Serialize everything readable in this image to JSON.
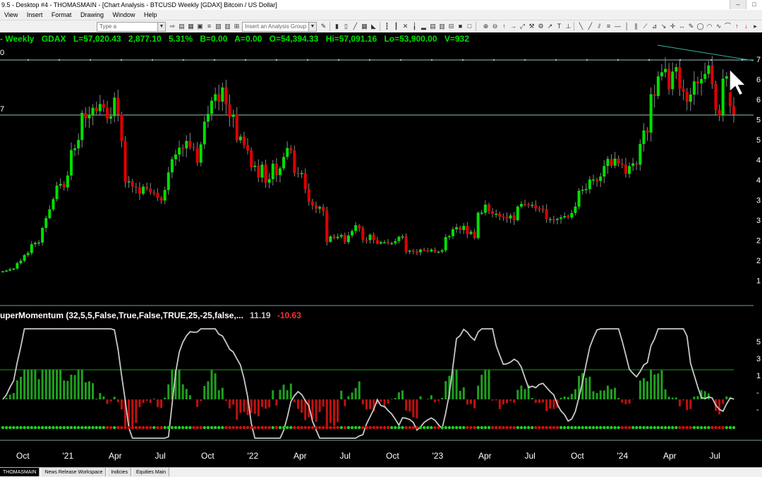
{
  "window": {
    "title": "9.5 - Desktop #4 - THOMASMAIN - [Chart Analysis - BTCUSD Weekly [GDAX] Bitcoin / US Dollar]"
  },
  "menu": {
    "items": [
      "View",
      "Insert",
      "Format",
      "Drawing",
      "Window",
      "Help"
    ]
  },
  "toolbar": {
    "symbol_placeholder": "Type a symbol/command",
    "analysis_group_placeholder": "Insert an Analysis Group"
  },
  "legend": {
    "interval": "- Weekly",
    "exchange": "GDAX",
    "last": "L=57,020.43",
    "change": "2,877.10",
    "change_pct": "5.31%",
    "bid": "B=0.00",
    "ask": "A=0.00",
    "open": "O=54,394.33",
    "high": "Hi=57,091.16",
    "low": "Lo=53,900.00",
    "volume": "V=932"
  },
  "indicator": {
    "name": "uperMomentum (32,5,5,False,True,False,TRUE,25,-25,false,...",
    "value1": "11.19",
    "value2": "-10.63"
  },
  "axis": {
    "price_left_top": "0",
    "price_left_mid": "7",
    "price_right": [
      "7",
      "6",
      "6",
      "5",
      "5",
      "4",
      "4",
      "3",
      "3",
      "2",
      "2",
      "1"
    ],
    "indicator_right": [
      "5",
      "3",
      "1",
      "-",
      "-"
    ],
    "months": [
      "Oct",
      "'21",
      "Apr",
      "Jul",
      "Oct",
      "'22",
      "Apr",
      "Jul",
      "Oct",
      "'23",
      "Apr",
      "Jul",
      "Oct",
      "'24",
      "Apr",
      "Jul"
    ]
  },
  "chart_data": {
    "type": "candlestick",
    "symbol": "BTCUSD",
    "ylim": [
      1000,
      75000
    ],
    "candles_note": "weekly OHLC Sep 2020 - Aug 2024",
    "closes": [
      10700,
      10900,
      11300,
      11500,
      13100,
      13800,
      15500,
      16100,
      18700,
      19100,
      19200,
      23500,
      26400,
      29000,
      32000,
      36000,
      36500,
      35500,
      39000,
      46500,
      47000,
      49500,
      57500,
      55900,
      57000,
      59000,
      58000,
      60100,
      59000,
      55800,
      56500,
      62000,
      57000,
      49200,
      37000,
      37300,
      35700,
      35500,
      33600,
      35700,
      35100,
      34000,
      33900,
      32400,
      31600,
      34700,
      39900,
      43800,
      45200,
      47200,
      47000,
      49200,
      47400,
      47100,
      42800,
      48200,
      54900,
      57200,
      61100,
      63000,
      60800,
      65000,
      60000,
      56300,
      57000,
      49400,
      50500,
      48000,
      46400,
      41500,
      41900,
      38400,
      42200,
      36900,
      37900,
      42500,
      39100,
      41100,
      44500,
      47100,
      46400,
      39700,
      39500,
      39700,
      35000,
      31300,
      30200,
      29200,
      29700,
      28600,
      19400,
      21000,
      20500,
      20900,
      21400,
      19300,
      21300,
      22600,
      24300,
      23400,
      20000,
      19900,
      21500,
      20000,
      18900,
      19300,
      19300,
      19000,
      19000,
      19600,
      20900,
      21000,
      16500,
      16800,
      16500,
      16300,
      17100,
      16800,
      16600,
      17100,
      16500,
      16500,
      16900,
      20800,
      21100,
      23100,
      23700,
      22900,
      24100,
      21700,
      22400,
      20500,
      28000,
      28000,
      30400,
      28500,
      27600,
      27700,
      26900,
      26800,
      26300,
      27200,
      25800,
      29800,
      30600,
      30500,
      30200,
      30300,
      29300,
      29200,
      29100,
      26100,
      26100,
      25900,
      26200,
      26600,
      27000,
      26600,
      27900,
      29800,
      34500,
      34800,
      35000,
      37800,
      37800,
      37400,
      38700,
      41800,
      43900,
      41900,
      44000,
      42500,
      42200,
      39500,
      41800,
      42600,
      42200,
      48300,
      52300,
      51700,
      63000,
      62500,
      68300,
      69500,
      70500,
      64500,
      69700,
      71000,
      64700,
      63700,
      60800,
      62900,
      66800,
      66200,
      67500,
      69000,
      71500,
      66000,
      58300,
      56700,
      67600,
      68300,
      59500,
      57020
    ]
  },
  "status_tabs": [
    "THOMASMAIN",
    "News Release Workspace",
    "Indicies",
    "Equities Main"
  ],
  "colors": {
    "up": "#00e000",
    "down": "#e00000",
    "oscillator_line": "#c8c8c8",
    "reference_line": "#80c0c0",
    "legend_green": "#00e000",
    "legend_red": "#ff3030"
  },
  "icons": [
    "cursor-arrow",
    "pin-icon",
    "eye-icon",
    "crosshair-icon",
    "zoom-icon"
  ]
}
